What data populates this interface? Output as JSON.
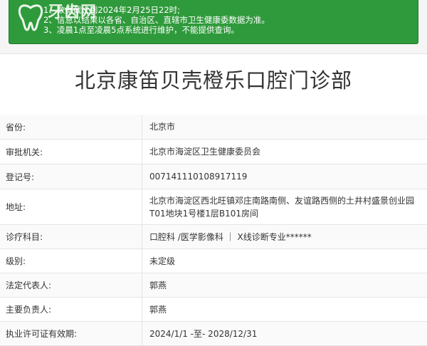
{
  "notice": {
    "lines": [
      "1、数据截止到2024年2月25日22时;",
      "2、信息以结果以各省、自治区、直辖市卫生健康委数据为准。",
      "3、凌晨1点至凌晨5点系统进行维护，不能提供查询。"
    ],
    "logo_text": "牙齿网",
    "background": "#2f9a3b"
  },
  "page": {
    "title": "北京康笛贝壳橙乐口腔门诊部"
  },
  "fields": [
    {
      "label": "省份:",
      "value": "北京市"
    },
    {
      "label": "审批机关:",
      "value": "北京市海淀区卫生健康委员会"
    },
    {
      "label": "登记号:",
      "value": "007141110108917119"
    },
    {
      "label": "地址:",
      "value": "北京市海淀区西北旺镇邓庄南路南侧、友谊路西侧的土井村盛景创业园T01地块1号楼1层B101房间"
    },
    {
      "label": "诊疗科目:",
      "value": "口腔科 /医学影像科 ｜ X线诊断专业******"
    },
    {
      "label": "级别:",
      "value": "未定级"
    },
    {
      "label": "法定代表人:",
      "value": "郭燕"
    },
    {
      "label": "主要负责人:",
      "value": "郭燕"
    },
    {
      "label": "执业许可证有效期:",
      "value": "2024/1/1 -至- 2028/12/31"
    }
  ]
}
